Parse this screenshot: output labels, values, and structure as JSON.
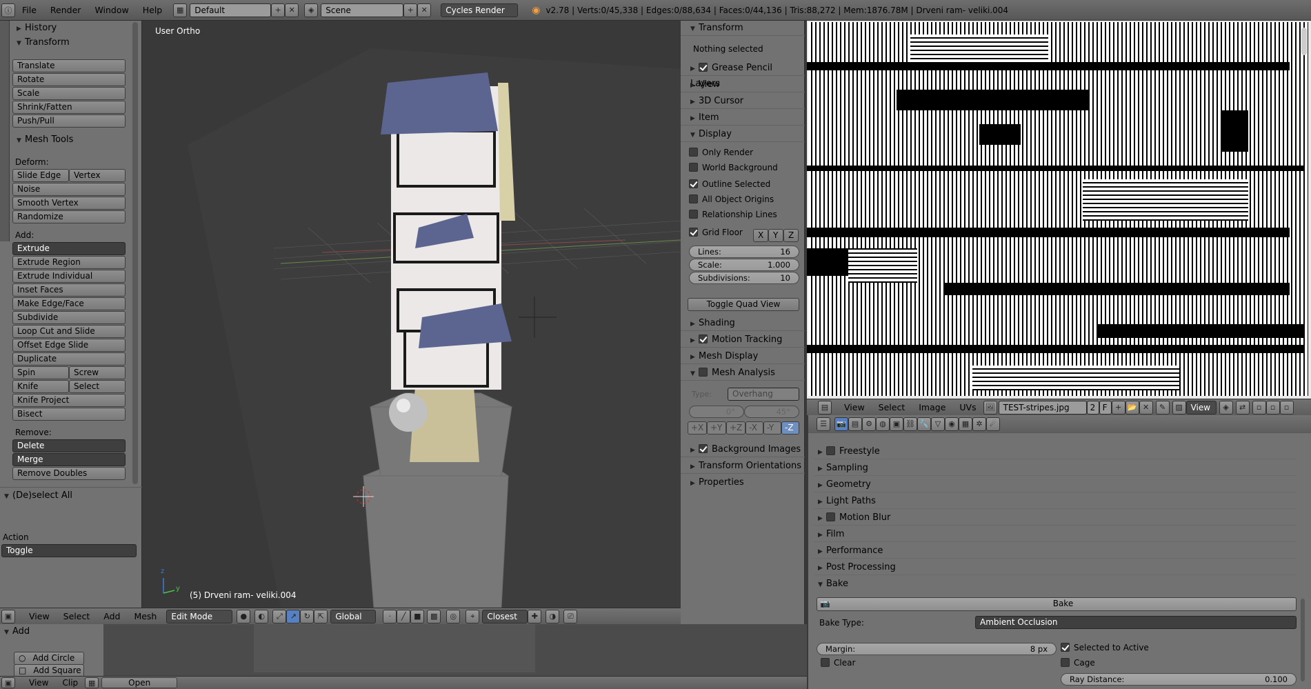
{
  "topbar": {
    "menus": [
      "File",
      "Render",
      "Window",
      "Help"
    ],
    "layout": "Default",
    "scene": "Scene",
    "engine": "Cycles Render",
    "stats": "v2.78 | Verts:0/45,338 | Edges:0/88,634 | Faces:0/44,136 | Tris:88,272 | Mem:1876.78M | Drveni ram- veliki.004"
  },
  "toolshelf": {
    "history": "History",
    "transform": "Transform",
    "transform_buttons": [
      "Translate",
      "Rotate",
      "Scale",
      "Shrink/Fatten",
      "Push/Pull"
    ],
    "mesh_tools": "Mesh Tools",
    "deform": "Deform:",
    "slide_edge": "Slide Edge",
    "vertex": "Vertex",
    "noise": "Noise",
    "smooth_vertex": "Smooth Vertex",
    "randomize": "Randomize",
    "add": "Add:",
    "extrude": "Extrude",
    "add_buttons": [
      "Extrude Region",
      "Extrude Individual",
      "Inset Faces",
      "Make Edge/Face",
      "Subdivide",
      "Loop Cut and Slide",
      "Offset Edge Slide",
      "Duplicate"
    ],
    "spin": "Spin",
    "screw": "Screw",
    "knife": "Knife",
    "select": "Select",
    "knife_project": "Knife Project",
    "bisect": "Bisect",
    "remove": "Remove:",
    "delete": "Delete",
    "merge": "Merge",
    "remove_doubles": "Remove Doubles",
    "deselect_all": "(De)select All",
    "action": "Action",
    "toggle": "Toggle"
  },
  "viewport": {
    "view_label": "User Ortho",
    "object_label": "(5) Drveni ram- veliki.004",
    "axis_x": "x",
    "axis_y": "y",
    "axis_z": "z"
  },
  "viewport_header": {
    "menus": [
      "View",
      "Select",
      "Add",
      "Mesh"
    ],
    "mode": "Edit Mode",
    "orientation": "Global",
    "snap": "Closest"
  },
  "npanel": {
    "transform": "Transform",
    "nothing_selected": "Nothing selected",
    "grease_pencil": "Grease Pencil Layers",
    "view": "View",
    "cursor": "3D Cursor",
    "item": "Item",
    "display": "Display",
    "display_opts": [
      {
        "label": "Only Render",
        "on": false
      },
      {
        "label": "World Background",
        "on": false
      },
      {
        "label": "Outline Selected",
        "on": true
      },
      {
        "label": "All Object Origins",
        "on": false
      },
      {
        "label": "Relationship Lines",
        "on": false
      }
    ],
    "grid_floor": "Grid Floor",
    "gx": "X",
    "gy": "Y",
    "gz": "Z",
    "lines_label": "Lines:",
    "lines_value": "16",
    "scale_label": "Scale:",
    "scale_value": "1.000",
    "subdiv_label": "Subdivisions:",
    "subdiv_value": "10",
    "toggle_quad": "Toggle Quad View",
    "shading": "Shading",
    "motion_tracking": "Motion Tracking",
    "mesh_display": "Mesh Display",
    "mesh_analysis": "Mesh Analysis",
    "type_label": "Type:",
    "type_value": "Overhang",
    "min_angle": "0°",
    "max_angle": "45°",
    "axes": [
      "+X",
      "+Y",
      "+Z",
      "-X",
      "-Y",
      "-Z"
    ],
    "background_images": "Background Images",
    "transform_orientations": "Transform Orientations",
    "properties": "Properties"
  },
  "uv_header": {
    "menus": [
      "View",
      "Select",
      "Image",
      "UVs"
    ],
    "image_name": "TEST-stripes.jpg",
    "users": "2",
    "fake": "F",
    "view": "View"
  },
  "properties": {
    "sections": [
      "Freestyle",
      "Sampling",
      "Geometry",
      "Light Paths",
      "Motion Blur",
      "Film",
      "Performance",
      "Post Processing",
      "Bake"
    ],
    "bake_button": "Bake",
    "bake_type_label": "Bake Type:",
    "bake_type_value": "Ambient Occlusion",
    "margin_label": "Margin:",
    "margin_value": "8 px",
    "selected_to_active": "Selected to Active",
    "clear": "Clear",
    "cage": "Cage",
    "ray_distance_label": "Ray Distance:",
    "ray_distance_value": "0.100"
  },
  "bottom_tool": {
    "add": "Add",
    "add_circle": "Add Circle",
    "add_square": "Add Square",
    "menus": [
      "View",
      "Clip"
    ],
    "open": "Open"
  }
}
